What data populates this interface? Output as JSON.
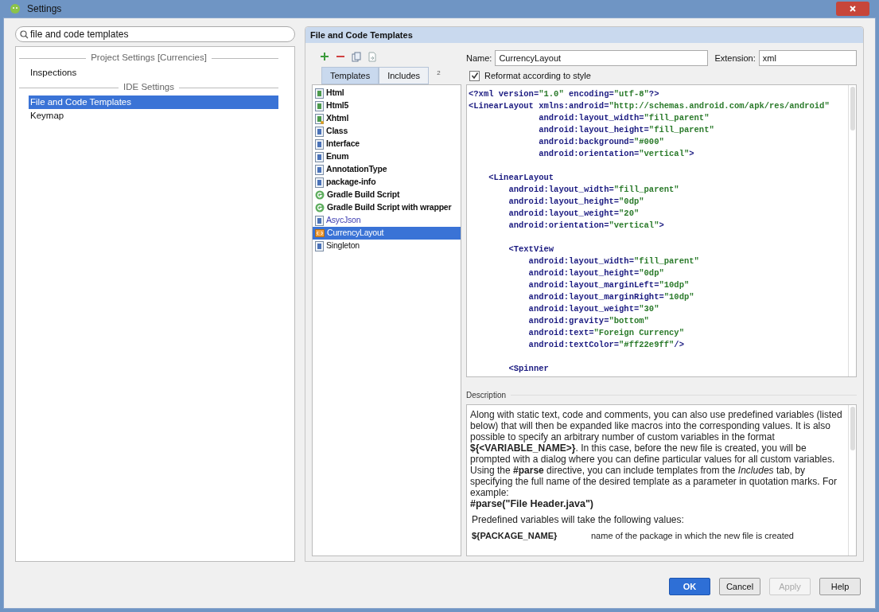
{
  "window": {
    "title": "Settings"
  },
  "search": {
    "value": "file and code templates"
  },
  "sidebar": {
    "groups": [
      {
        "heading": "Project Settings [Currencies]",
        "items": [
          {
            "label": "Inspections",
            "selected": false
          }
        ]
      },
      {
        "heading": "IDE Settings",
        "items": [
          {
            "label": "File and Code Templates",
            "selected": true
          },
          {
            "label": "Keymap",
            "selected": false
          }
        ]
      }
    ]
  },
  "panel": {
    "title": "File and Code Templates",
    "toolbar": [
      {
        "kind": "add"
      },
      {
        "kind": "remove"
      },
      {
        "kind": "copy"
      },
      {
        "kind": "reset"
      }
    ],
    "tabs": [
      {
        "label": "Templates",
        "selected": true
      },
      {
        "label": "Includes",
        "selected": false
      }
    ],
    "tab_overflow": "2",
    "templates": [
      {
        "label": "Html",
        "kind": "html",
        "custom": false,
        "selected": false
      },
      {
        "label": "Html5",
        "kind": "html",
        "custom": false,
        "selected": false
      },
      {
        "label": "Xhtml",
        "kind": "xhtml",
        "custom": false,
        "selected": false
      },
      {
        "label": "Class",
        "kind": "java",
        "custom": false,
        "selected": false
      },
      {
        "label": "Interface",
        "kind": "java",
        "custom": false,
        "selected": false
      },
      {
        "label": "Enum",
        "kind": "java",
        "custom": false,
        "selected": false
      },
      {
        "label": "AnnotationType",
        "kind": "java",
        "custom": false,
        "selected": false
      },
      {
        "label": "package-info",
        "kind": "java",
        "custom": false,
        "selected": false
      },
      {
        "label": "Gradle Build Script",
        "kind": "gradle",
        "custom": false,
        "selected": false
      },
      {
        "label": "Gradle Build Script with wrapper",
        "kind": "gradle",
        "custom": false,
        "selected": false
      },
      {
        "label": "AsycJson",
        "kind": "java",
        "custom": true,
        "modified": true,
        "selected": false
      },
      {
        "label": "CurrencyLayout",
        "kind": "xml",
        "custom": true,
        "modified": false,
        "selected": true
      },
      {
        "label": "Singleton",
        "kind": "java",
        "custom": true,
        "modified": false,
        "selected": false
      }
    ],
    "name_label": "Name:",
    "name_value": "CurrencyLayout",
    "extension_label": "Extension:",
    "extension_value": "xml",
    "reformat": {
      "label": "Reformat according to style",
      "checked": true
    },
    "code_blocks": [
      [
        "<?xml version=\"1.0\" encoding=\"utf-8\"?>",
        "<LinearLayout xmlns:android=\"http://schemas.android.com/apk/res/android\"",
        "              android:layout_width=\"fill_parent\"",
        "              android:layout_height=\"fill_parent\"",
        "              android:background=\"#000\"",
        "              android:orientation=\"vertical\">"
      ],
      [
        "    <LinearLayout",
        "        android:layout_width=\"fill_parent\"",
        "        android:layout_height=\"0dp\"",
        "        android:layout_weight=\"20\"",
        "        android:orientation=\"vertical\">"
      ],
      [
        "        <TextView",
        "            android:layout_width=\"fill_parent\"",
        "            android:layout_height=\"0dp\"",
        "            android:layout_marginLeft=\"10dp\"",
        "            android:layout_marginRight=\"10dp\"",
        "            android:layout_weight=\"30\"",
        "            android:gravity=\"bottom\"",
        "            android:text=\"Foreign Currency\"",
        "            android:textColor=\"#ff22e9ff\"/>"
      ],
      [
        "        <Spinner"
      ]
    ],
    "description_label": "Description",
    "description": {
      "paragraph": "Along with static text, code and comments, you can also use predefined variables (listed below) that will then be expanded like macros into the corresponding values. It is also possible to specify an arbitrary number of custom variables in the format **${<VARIABLE_NAME>}**. In this case, before the new file is created, you will be prompted with a dialog where you can define particular values for all custom variables.",
      "paragraph2": "Using the **#parse** directive, you can include templates from the *Includes* tab, by specifying the full name of the desired template as a parameter in quotation marks. For example:",
      "example": "#parse(\"File Header.java\")",
      "predefined": "Predefined variables will take the following values:",
      "variables": [
        {
          "name": "${PACKAGE_NAME}",
          "meaning": "name of the package in which the new file is created"
        }
      ]
    }
  },
  "buttons": [
    {
      "label": "OK",
      "kind": "default"
    },
    {
      "label": "Cancel",
      "kind": "normal"
    },
    {
      "label": "Apply",
      "kind": "disabled"
    },
    {
      "label": "Help",
      "kind": "normal"
    }
  ]
}
